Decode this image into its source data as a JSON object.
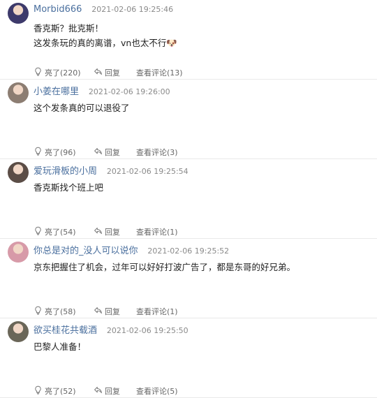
{
  "comments": [
    {
      "username": "Morbid666",
      "time": "2021-02-06 19:25:46",
      "lines": [
        "香克斯？批克斯！",
        "这发条玩的真的离谱，vn也太不行🐶"
      ],
      "likes_label": "亮了(220)",
      "reply_label": "回复",
      "view_label": "查看评论(13)",
      "avatar_color": "#3d3a6b"
    },
    {
      "username": "小姜在哪里",
      "time": "2021-02-06 19:26:00",
      "lines": [
        "这个发条真的可以退役了"
      ],
      "likes_label": "亮了(96)",
      "reply_label": "回复",
      "view_label": "查看评论(3)",
      "avatar_color": "#8c7d72"
    },
    {
      "username": "爱玩滑板的小周",
      "time": "2021-02-06 19:25:54",
      "lines": [
        "香克斯找个班上吧"
      ],
      "likes_label": "亮了(54)",
      "reply_label": "回复",
      "view_label": "查看评论(1)",
      "avatar_color": "#5b4d46"
    },
    {
      "username": "你总是对的_没人可以说你",
      "time": "2021-02-06 19:25:52",
      "lines": [
        "京东把握住了机会，过年可以好好打波广告了，都是东哥的好兄弟。"
      ],
      "likes_label": "亮了(58)",
      "reply_label": "回复",
      "view_label": "查看评论(1)",
      "avatar_color": "#d79aa8"
    },
    {
      "username": "欲买桂花共载酒",
      "time": "2021-02-06 19:25:50",
      "lines": [
        "巴黎人准备！"
      ],
      "likes_label": "亮了(52)",
      "reply_label": "回复",
      "view_label": "查看评论(5)",
      "avatar_color": "#6a6658"
    }
  ],
  "colors": {
    "username": "#4a6f9e",
    "timestamp": "#8a8a8a",
    "action": "#666666",
    "divider": "#e9e9e9"
  },
  "icons": {
    "like": "lightbulb-icon",
    "reply": "reply-arrow-icon"
  }
}
